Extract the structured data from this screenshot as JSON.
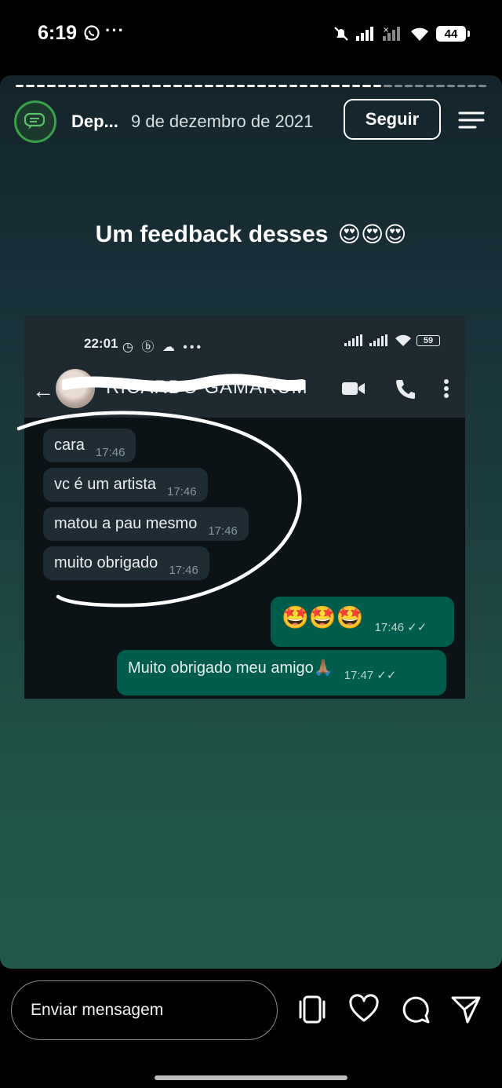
{
  "status_bar": {
    "time": "6:19",
    "battery": "44"
  },
  "story": {
    "author": "Dep...",
    "date": "9 de dezembro de 2021",
    "follow_label": "Seguir",
    "caption": "Um feedback desses",
    "caption_emoji": "😍😍😍"
  },
  "whatsapp": {
    "time": "22:01",
    "status_icons": "◷ ⓑ ☁ •••",
    "battery": "59",
    "contact_name": "RICARDO GAMARUM",
    "messages": [
      {
        "text": "cara",
        "time": "17:46"
      },
      {
        "text": "vc é um artista",
        "time": "17:46"
      },
      {
        "text": "matou a pau mesmo",
        "time": "17:46"
      },
      {
        "text": "muito obrigado",
        "time": "17:46"
      }
    ],
    "sent": [
      {
        "text": "🤩🤩🤩",
        "time": "17:46"
      },
      {
        "text": "Muito obrigado meu amigo🙏🏽",
        "time": "17:47"
      }
    ]
  },
  "bottom": {
    "message_placeholder": "Enviar mensagem"
  },
  "colors": {
    "follow_ring": "#3aa14a",
    "wa_incoming": "#202c33",
    "wa_outgoing": "#005c4b"
  }
}
